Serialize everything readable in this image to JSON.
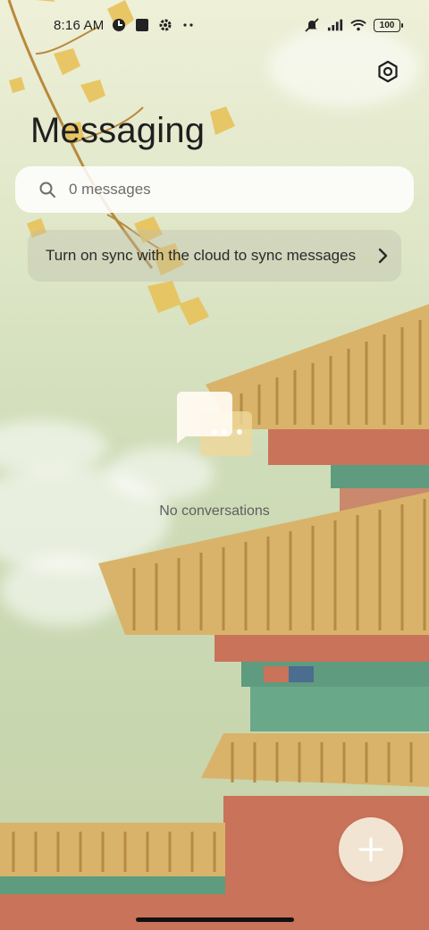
{
  "status_bar": {
    "time": "8:16 AM",
    "left_icons": [
      "app-notification-icon",
      "square-notification-icon",
      "settings-gear-icon",
      "more-dots-icon"
    ],
    "right_icons": [
      "mute-icon",
      "signal-icon",
      "wifi-icon",
      "battery-icon"
    ],
    "battery_level": "100"
  },
  "header": {
    "title": "Messaging",
    "settings_icon": "gear-icon"
  },
  "search": {
    "placeholder": "0 messages",
    "icon": "search-icon"
  },
  "sync_banner": {
    "text": "Turn on sync with the cloud to sync messages",
    "icon": "chevron-right-icon"
  },
  "empty_state": {
    "icon": "chat-bubbles-icon",
    "text": "No conversations"
  },
  "fab": {
    "icon": "plus-icon"
  },
  "colors": {
    "title": "#1f1f1f",
    "search_bg": "#ffffff",
    "fab_bg": "#f5eedc",
    "roof_gold": "#d9b36a",
    "wall_red": "#c9735a",
    "beam_green": "#5f9b7f"
  }
}
